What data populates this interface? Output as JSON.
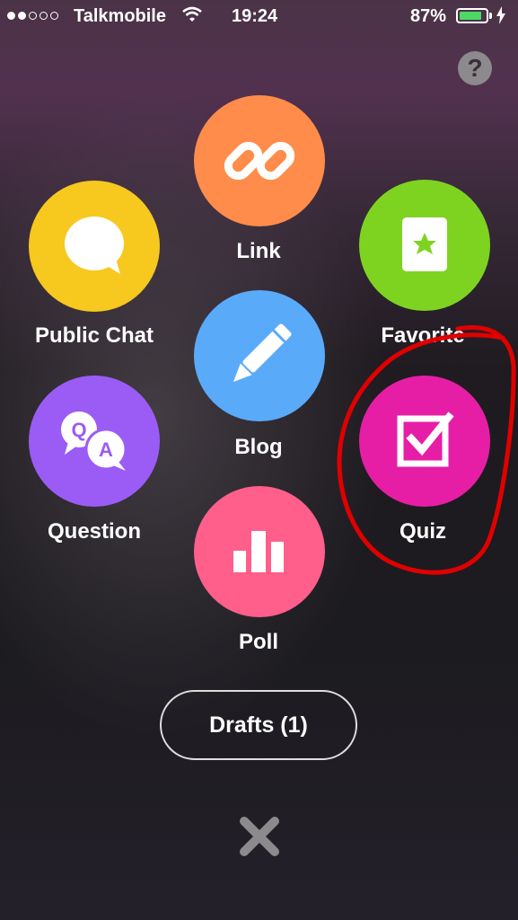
{
  "status_bar": {
    "carrier": "Talkmobile",
    "time": "19:24",
    "battery_percent": "87%",
    "battery_level": 0.87,
    "signal_bars_filled": 2,
    "signal_bars_total": 5
  },
  "help_button": {
    "label": "?"
  },
  "menu": {
    "link": {
      "label": "Link",
      "color": "#ff8c4a",
      "icon": "link-icon"
    },
    "public_chat": {
      "label": "Public Chat",
      "color": "#f7c81e",
      "icon": "chat-bubble-icon"
    },
    "favorite": {
      "label": "Favorite",
      "color": "#7ed321",
      "icon": "favorite-card-icon"
    },
    "blog": {
      "label": "Blog",
      "color": "#5aaafa",
      "icon": "pencil-icon"
    },
    "question": {
      "label": "Question",
      "color": "#9a5cf5",
      "icon": "qa-bubbles-icon"
    },
    "quiz": {
      "label": "Quiz",
      "color": "#e61ea6",
      "icon": "checkbox-icon"
    },
    "poll": {
      "label": "Poll",
      "color": "#ff5f8a",
      "icon": "bar-chart-icon"
    }
  },
  "drafts_button": {
    "label": "Drafts (1)"
  },
  "close_button": {
    "icon": "close-icon"
  },
  "annotation": {
    "color": "#e00000"
  }
}
